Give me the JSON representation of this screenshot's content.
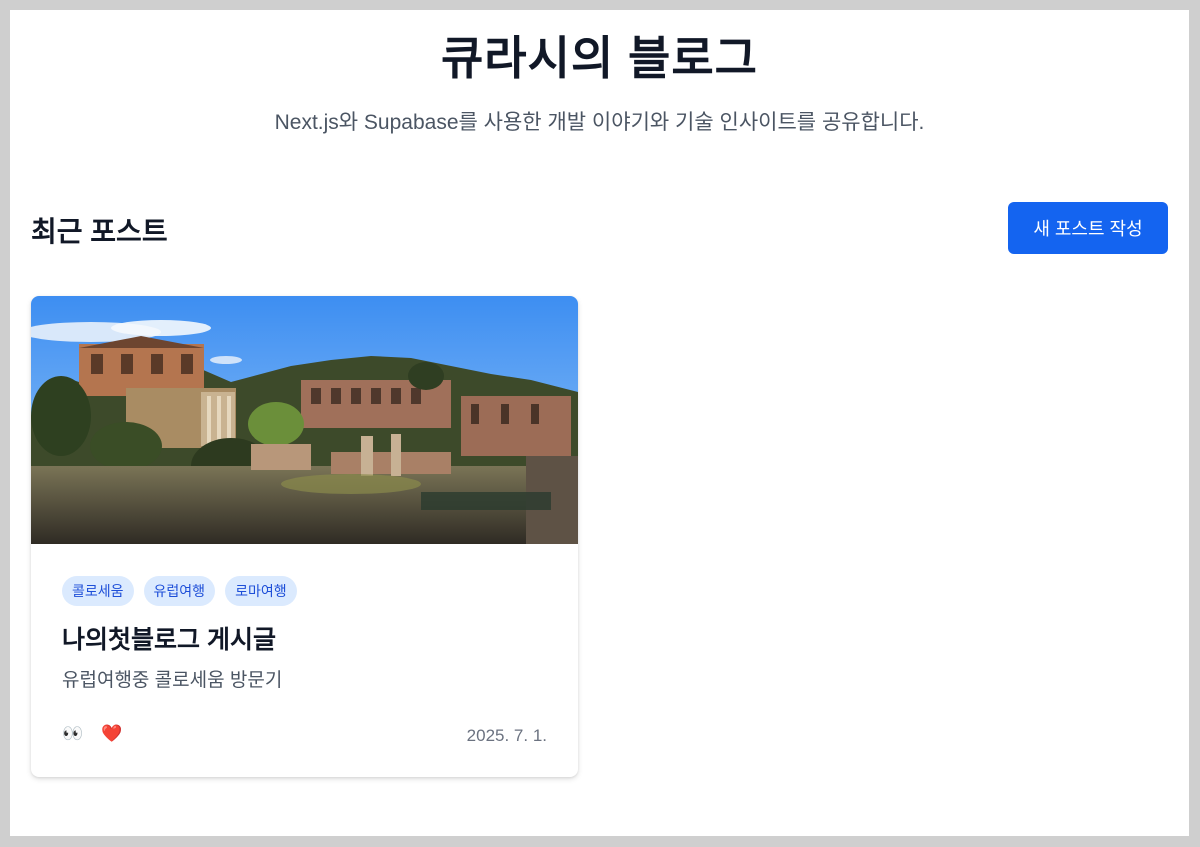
{
  "header": {
    "title": "큐라시의 블로그",
    "subtitle": "Next.js와 Supabase를 사용한 개발 이야기와 기술 인사이트를 공유합니다."
  },
  "posts_section": {
    "title": "최근 포스트",
    "new_post_label": "새 포스트 작성"
  },
  "posts": [
    {
      "tags": [
        "콜로세움",
        "유럽여행",
        "로마여행"
      ],
      "title": "나의첫블로그 게시글",
      "excerpt": "유럽여행중 콜로세움 방문기",
      "reactions": [
        {
          "icon": "eyes-icon",
          "glyph": "👀"
        },
        {
          "icon": "heart-icon",
          "glyph": "❤️"
        }
      ],
      "date": "2025. 7. 1."
    }
  ],
  "colors": {
    "accent": "#1464f0",
    "tag_bg": "#dbeafe",
    "tag_text": "#1d4ed8",
    "text_primary": "#111827",
    "text_secondary": "#4b5563"
  }
}
